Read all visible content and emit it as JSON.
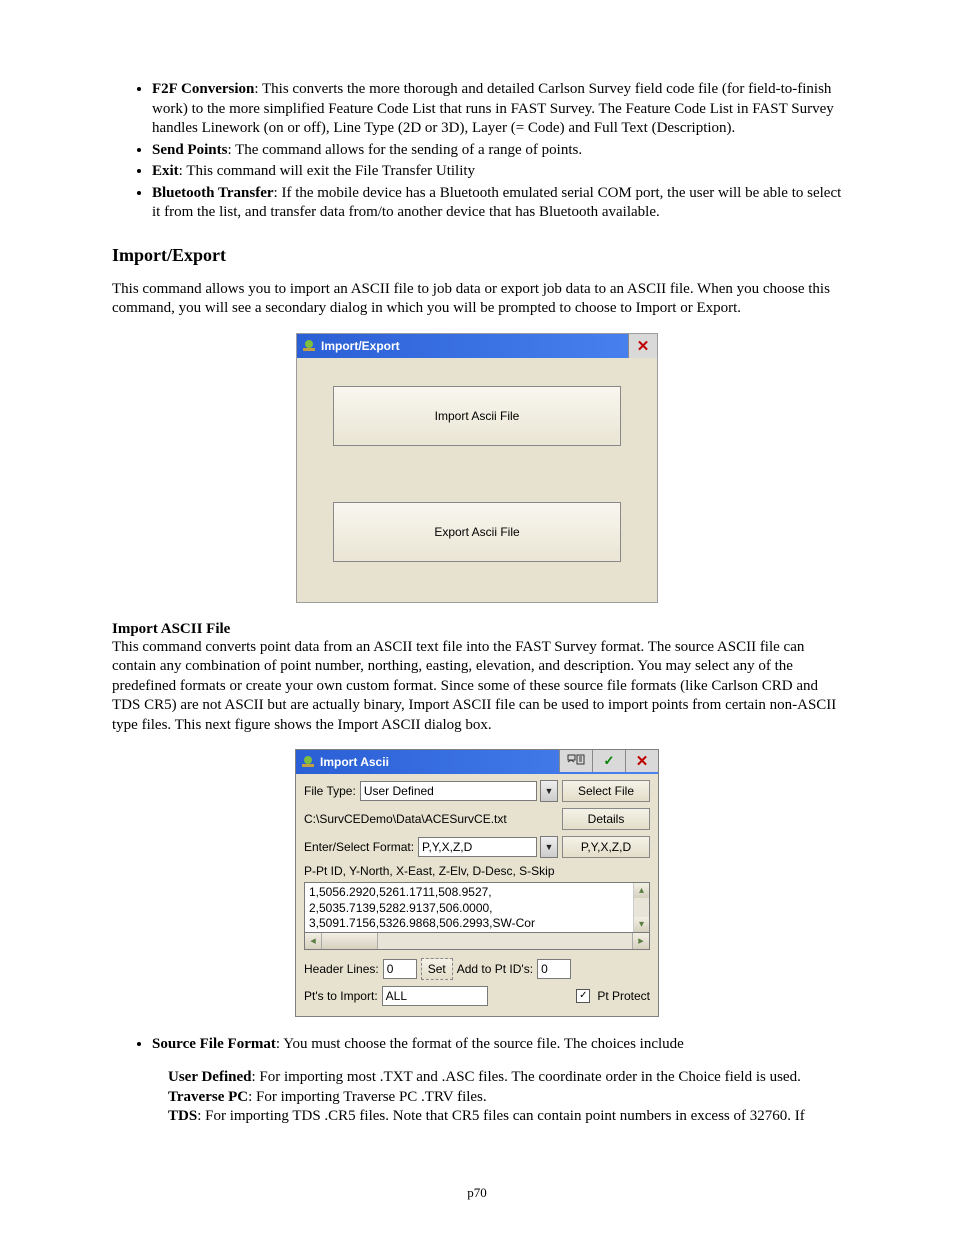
{
  "bullets_top": [
    {
      "lead": "F2F Conversion",
      "text": ": This converts the more thorough and detailed Carlson Survey field code file (for field-to-finish work) to the more simplified Feature Code List that runs in FAST Survey.  The Feature Code List in FAST Survey handles Linework (on or off), Line Type (2D or 3D), Layer (= Code) and Full Text (Description)."
    },
    {
      "lead": "Send Points",
      "text": ": The command allows for the sending of a range of points."
    },
    {
      "lead": "Exit",
      "text": ": This command will exit the File Transfer Utility"
    },
    {
      "lead": "Bluetooth Transfer",
      "text": ": If the mobile device has a Bluetooth emulated serial COM port, the user will be able to select it from the list, and transfer data from/to another device that has Bluetooth available."
    }
  ],
  "heading1": "Import/Export",
  "intro1": "This command allows you to import an ASCII file to job data or export job data to an ASCII file. When you choose this command, you will see a secondary dialog in which you will be prompted to choose to Import or Export.",
  "dialog1": {
    "title": "Import/Export",
    "import_btn": "Import Ascii File",
    "export_btn": "Export Ascii File"
  },
  "subheading1": "Import ASCII File",
  "para_import": "This command converts point data from an ASCII text file into the FAST Survey format. The source ASCII file can contain any combination of point number, northing, easting, elevation, and description. You may select any of the predefined formats or create your own custom format. Since some of these source file formats (like Carlson CRD and TDS CR5) are not ASCII but are actually binary, Import ASCII file can be used to import points from certain non-ASCII type files. This next figure shows the Import ASCII dialog box.",
  "dialog2": {
    "title": "Import Ascii",
    "file_type_label": "File Type:",
    "file_type_value": "User Defined",
    "select_file": "Select File",
    "path": "C:\\SurvCEDemo\\Data\\ACESurvCE.txt",
    "details": "Details",
    "enter_select_label": "Enter/Select Format:",
    "format_value": "P,Y,X,Z,D",
    "format_btn": "P,Y,X,Z,D",
    "legend": "P-Pt ID, Y-North, X-East, Z-Elv, D-Desc, S-Skip",
    "preview_lines": [
      "1,5056.2920,5261.1711,508.9527,",
      "2,5035.7139,5282.9137,506.0000,",
      "3,5091.7156,5326.9868,506.2993,SW-Cor"
    ],
    "header_lines_label": "Header Lines:",
    "header_lines_value": "0",
    "set_btn": "Set",
    "add_to_label": "Add to Pt ID's:",
    "add_to_value": "0",
    "pts_import_label": "Pt's to Import:",
    "pts_import_value": "ALL",
    "pt_protect": "Pt Protect"
  },
  "bullets_bottom": [
    {
      "lead": "Source File Format",
      "text": ": You must choose the format of the source file. The choices include"
    }
  ],
  "sub_items": [
    {
      "lead": "User Defined",
      "text": ": For importing most .TXT and .ASC files. The coordinate order in the Choice field is used."
    },
    {
      "lead": "Traverse PC",
      "text": ": For importing Traverse PC .TRV files."
    },
    {
      "lead": "TDS",
      "text": ": For importing TDS .CR5 files.  Note that CR5 files can contain point numbers in excess of 32760.  If"
    }
  ],
  "page_number": "p70"
}
